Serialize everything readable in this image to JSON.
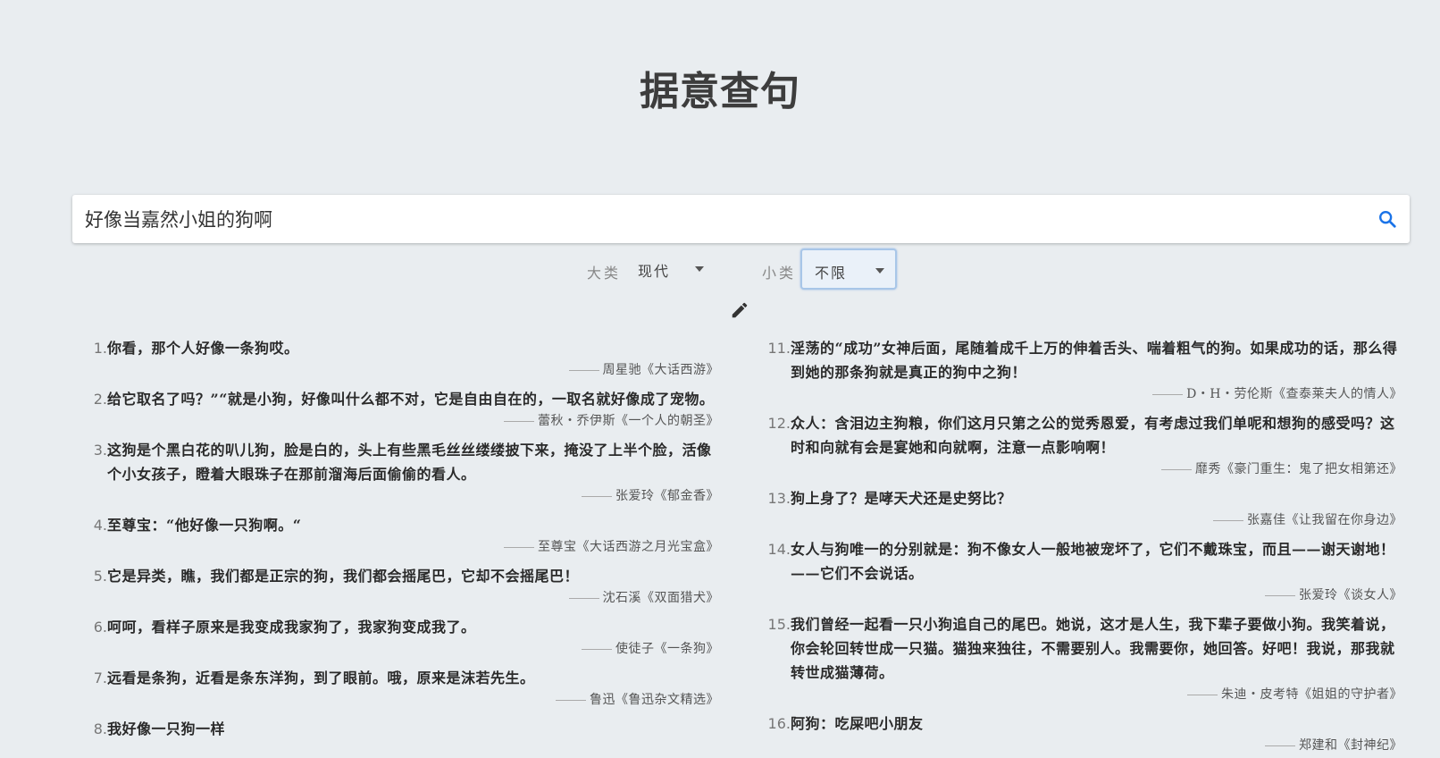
{
  "title": "据意查句",
  "search": {
    "value": "好像当嘉然小姐的狗啊"
  },
  "filters": {
    "major_label": "大类",
    "major_value": "现代",
    "minor_label": "小类",
    "minor_value": "不限"
  },
  "left_items": [
    {
      "num": "1.",
      "text": "你看，那个人好像一条狗哎。",
      "source": "周星驰《大话西游》"
    },
    {
      "num": "2.",
      "text": "给它取名了吗？”“就是小狗，好像叫什么都不对，它是自由自在的，一取名就好像成了宠物。",
      "source": "蕾秋・乔伊斯《一个人的朝圣》"
    },
    {
      "num": "3.",
      "text": "这狗是个黑白花的叭儿狗，脸是白的，头上有些黑毛丝丝缕缕披下来，掩没了上半个脸，活像个小女孩子，瞪着大眼珠子在那前溜海后面偷偷的看人。",
      "source": "张爱玲《郁金香》"
    },
    {
      "num": "4.",
      "text": "至尊宝：“他好像一只狗啊。“",
      "source": "至尊宝《大话西游之月光宝盒》"
    },
    {
      "num": "5.",
      "text": "它是异类，瞧，我们都是正宗的狗，我们都会摇尾巴，它却不会摇尾巴！",
      "source": "沈石溪《双面猎犬》"
    },
    {
      "num": "6.",
      "text": "呵呵，看样子原来是我变成我家狗了，我家狗变成我了。",
      "source": "使徒子《一条狗》"
    },
    {
      "num": "7.",
      "text": "远看是条狗，近看是条东洋狗，到了眼前。哦，原来是沫若先生。",
      "source": "鲁迅《鲁迅杂文精选》"
    },
    {
      "num": "8.",
      "text": "我好像一只狗一样",
      "source": ""
    }
  ],
  "right_items": [
    {
      "num": "11.",
      "text": "淫荡的“成功”女神后面，尾随着成千上万的伸着舌头、喘着粗气的狗。如果成功的话，那么得到她的那条狗就是真正的狗中之狗！",
      "source": "D・H・劳伦斯《查泰莱夫人的情人》"
    },
    {
      "num": "12.",
      "text": "众人：含泪边主狗粮，你们这月只第之公的觉秀恩爱，有考虑过我们单呢和想狗的感受吗？这时和向就有会是宴她和向就啊，注意一点影响啊！",
      "source": "靡秀《豪门重生：鬼了把女相第还》"
    },
    {
      "num": "13.",
      "text": "狗上身了？是哮天犬还是史努比？",
      "source": "张嘉佳《让我留在你身边》"
    },
    {
      "num": "14.",
      "text": "女人与狗唯一的分别就是：狗不像女人一般地被宠坏了，它们不戴珠宝，而且——谢天谢地！——它们不会说话。",
      "source": "张爱玲《谈女人》"
    },
    {
      "num": "15.",
      "text": "我们曾经一起看一只小狗追自己的尾巴。她说，这才是人生，我下辈子要做小狗。我笑着说，你会轮回转世成一只猫。猫独来独往，不需要别人。我需要你，她回答。好吧！我说，那我就转世成猫薄荷。",
      "source": "朱迪・皮考特《姐姐的守护者》"
    },
    {
      "num": "16.",
      "text": "阿狗：吃屎吧小朋友",
      "source": "郑建和《封神纪》"
    }
  ]
}
